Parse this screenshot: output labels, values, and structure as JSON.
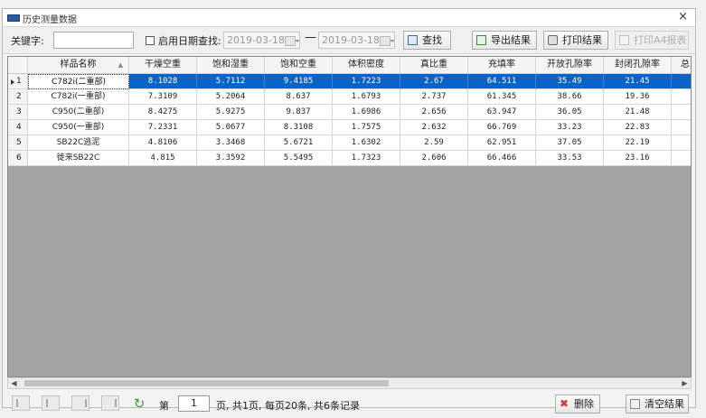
{
  "window": {
    "title": "历史测量数据",
    "close": "×"
  },
  "toolbar": {
    "keyword_label": "关键字:",
    "keyword_value": "",
    "date_filter_label": "启用日期查找:",
    "date_from": "2019-03-18",
    "date_to": "2019-03-18",
    "dash": "—",
    "search_label": "查找",
    "export_label": "导出结果",
    "print_label": "打印结果",
    "print_a4_label": "打印A4报表"
  },
  "table": {
    "columns": [
      "样品名称",
      "干燥空重",
      "饱和湿重",
      "饱和空重",
      "体积密度",
      "真比重",
      "充填率",
      "开放孔隙率",
      "封闭孔隙率",
      "总"
    ],
    "rows": [
      {
        "no": "1",
        "cells": [
          "C782i(二重部)",
          "8.1028",
          "5.7112",
          "9.4185",
          "1.7223",
          "2.67",
          "64.511",
          "35.49",
          "21.45"
        ]
      },
      {
        "no": "2",
        "cells": [
          "C782i(一重部)",
          "7.3109",
          "5.2064",
          "8.637",
          "1.6793",
          "2.737",
          "61.345",
          "38.66",
          "19.36"
        ]
      },
      {
        "no": "3",
        "cells": [
          "C950(二重部)",
          "8.4275",
          "5.9275",
          "9.837",
          "1.6986",
          "2.656",
          "63.947",
          "36.05",
          "21.48"
        ]
      },
      {
        "no": "4",
        "cells": [
          "C950(一重部)",
          "7.2331",
          "5.0677",
          "8.3108",
          "1.7575",
          "2.632",
          "66.769",
          "33.23",
          "22.83"
        ]
      },
      {
        "no": "5",
        "cells": [
          "SB22C逃泥",
          "4.8106",
          "3.3468",
          "5.6721",
          "1.6302",
          "2.59",
          "62.951",
          "37.05",
          "22.19"
        ]
      },
      {
        "no": "6",
        "cells": [
          "徙来SB22C",
          "4.815",
          "3.3592",
          "5.5495",
          "1.7323",
          "2.606",
          "66.466",
          "33.53",
          "23.16"
        ]
      }
    ],
    "selected_row": 1
  },
  "pager": {
    "page_prefix": "第",
    "page_value": "1",
    "page_info": "页, 共1页, 每页20条, 共6条记录",
    "delete_label": "删除",
    "clear_label": "清空结果"
  },
  "colors": {
    "selection": "#0a64c8",
    "grid_bg": "#a3a3a3"
  }
}
